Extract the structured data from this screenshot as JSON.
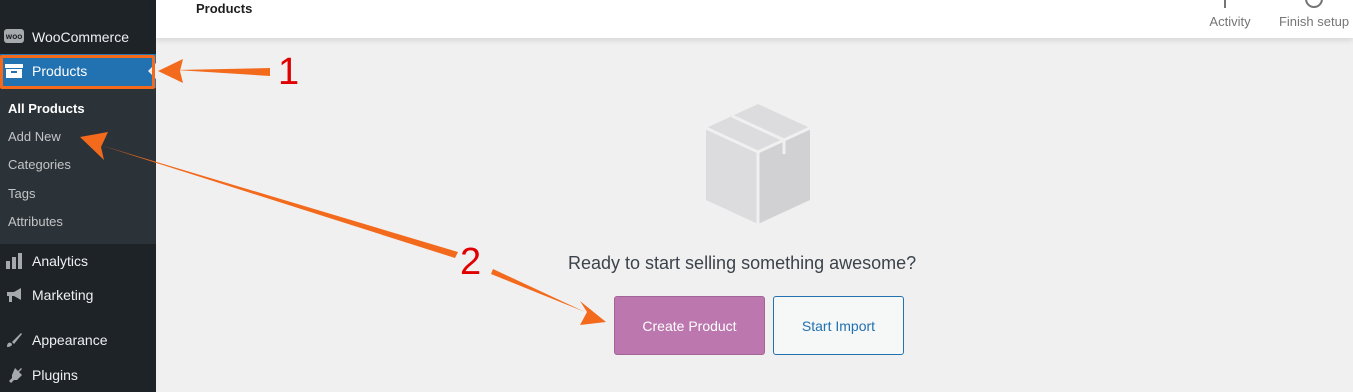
{
  "sidebar": {
    "items": [
      {
        "label": "WooCommerce",
        "icon": "woo-icon"
      },
      {
        "label": "Products",
        "icon": "archive-icon",
        "active": true
      },
      {
        "label": "Analytics",
        "icon": "bar-chart-icon"
      },
      {
        "label": "Marketing",
        "icon": "megaphone-icon"
      },
      {
        "label": "Appearance",
        "icon": "paintbrush-icon"
      },
      {
        "label": "Plugins",
        "icon": "plug-icon"
      }
    ],
    "submenu": [
      {
        "label": "All Products",
        "current": true
      },
      {
        "label": "Add New"
      },
      {
        "label": "Categories"
      },
      {
        "label": "Tags"
      },
      {
        "label": "Attributes"
      }
    ]
  },
  "header": {
    "title": "Products",
    "activity_label": "Activity",
    "finish_setup_label": "Finish setup"
  },
  "main": {
    "empty_title": "Ready to start selling something awesome?",
    "create_product_label": "Create Product",
    "start_import_label": "Start Import"
  },
  "annotations": {
    "step_1": "1",
    "step_2": "2"
  },
  "colors": {
    "sidebar_bg": "#1d2327",
    "submenu_bg": "#2c3338",
    "active_bg": "#2271b1",
    "primary_button": "#bb77ae",
    "annotation_arrow": "#f36a1d",
    "annotation_number": "#e00000"
  }
}
